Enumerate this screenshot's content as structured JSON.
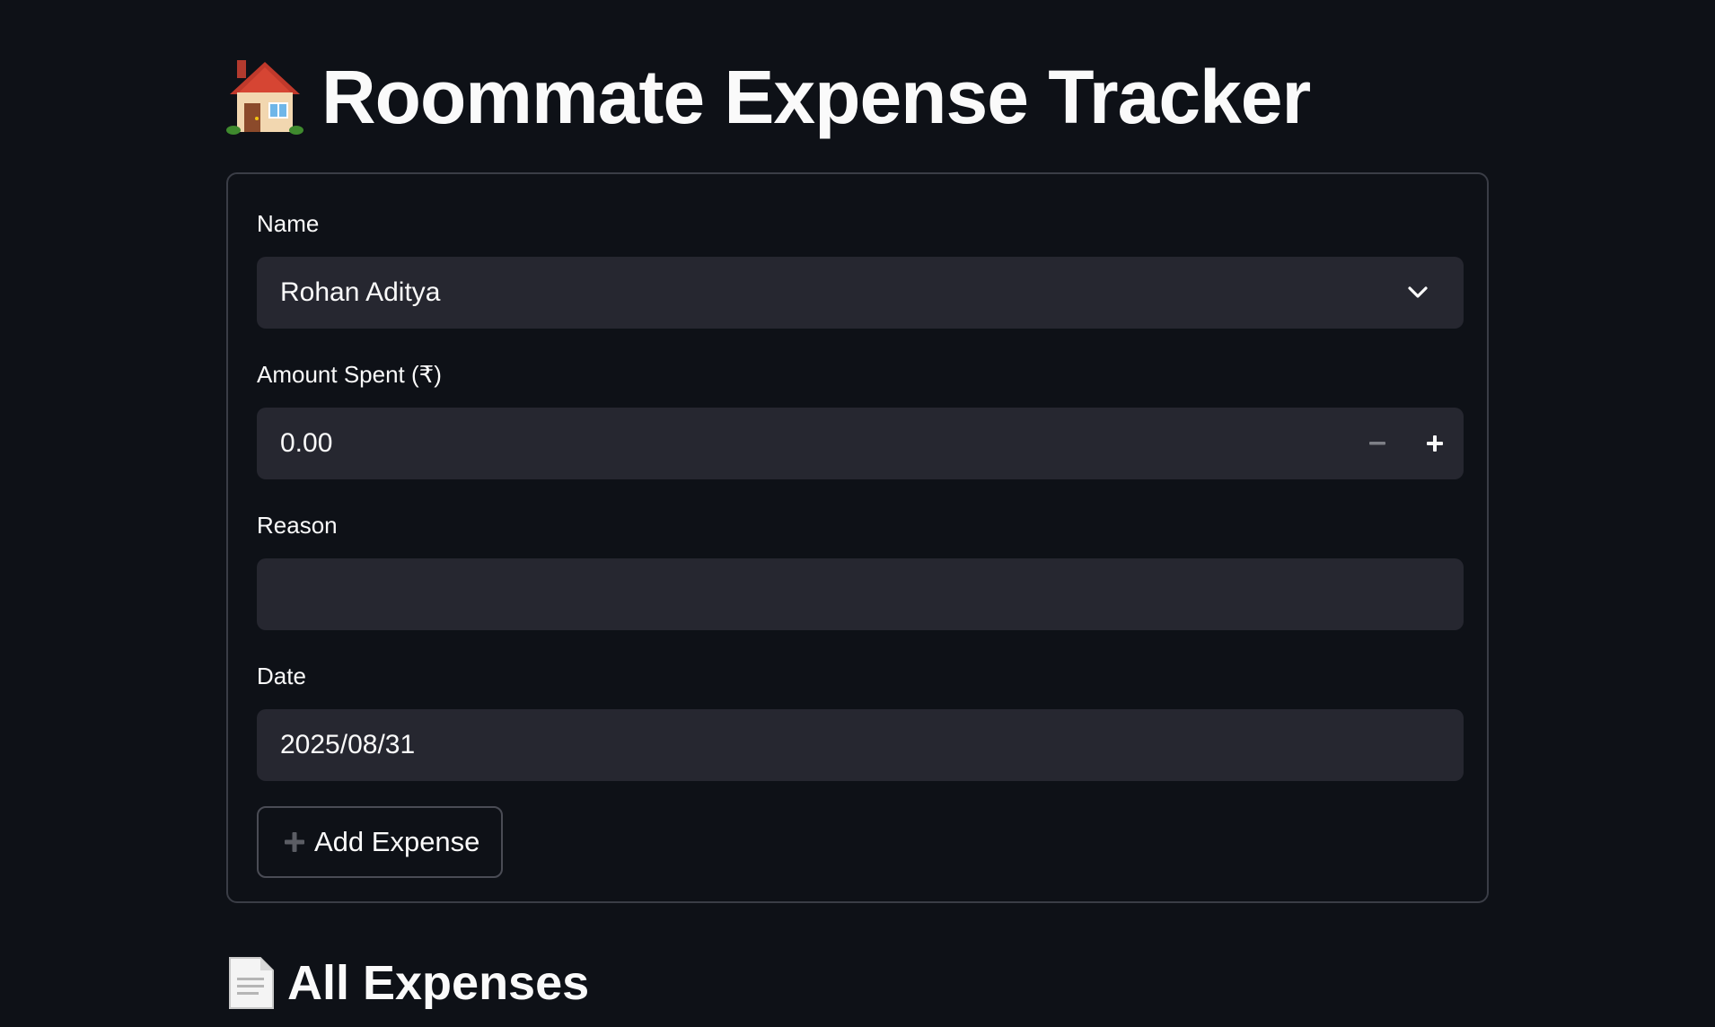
{
  "header": {
    "title": "Roommate Expense Tracker",
    "icon": "house-icon"
  },
  "form": {
    "name_label": "Name",
    "name_value": "Rohan Aditya",
    "amount_label": "Amount Spent (₹)",
    "amount_value": "0.00",
    "reason_label": "Reason",
    "reason_value": "",
    "date_label": "Date",
    "date_value": "2025/08/31",
    "submit_label": "Add Expense"
  },
  "expenses_section": {
    "title": "All Expenses",
    "icon": "document-icon"
  },
  "colors": {
    "background": "#0e1117",
    "field_background": "#262730",
    "text": "#fafafa",
    "border": "#3a3d46"
  }
}
